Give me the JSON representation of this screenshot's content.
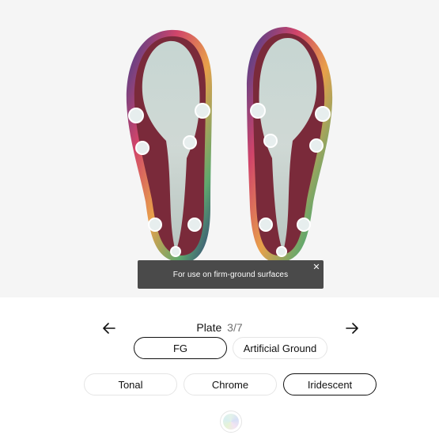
{
  "viewer": {
    "tooltip_text": "For use on firm-ground surfaces",
    "close_glyph": "✕"
  },
  "step": {
    "name": "Plate",
    "count": "3/7",
    "prev_icon": "arrow-left-icon",
    "next_icon": "arrow-right-icon"
  },
  "plate_options": [
    {
      "label": "FG",
      "selected": true
    },
    {
      "label": "Artificial Ground",
      "selected": false
    }
  ],
  "finish_options": [
    {
      "label": "Tonal",
      "selected": false
    },
    {
      "label": "Chrome",
      "selected": false
    },
    {
      "label": "Iridescent",
      "selected": true
    }
  ],
  "colors": {
    "viewer_bg": "#f5f5f5",
    "tooltip_bg": "#4a4a4a",
    "selected_border": "#111111",
    "sole_plate": "#c9e6df",
    "sole_base": "#7a2a3a"
  }
}
